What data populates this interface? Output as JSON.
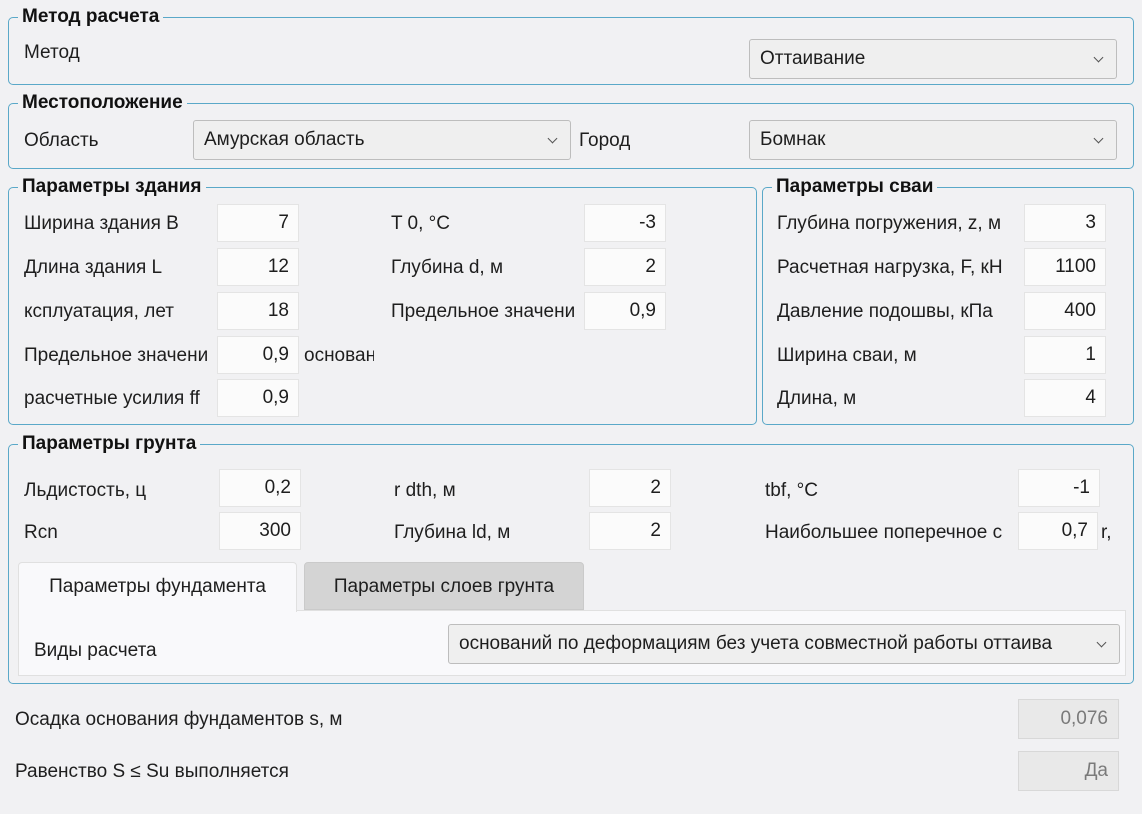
{
  "method_group": {
    "title": "Метод расчета",
    "method_label": "Метод",
    "method_value": "Оттаивание"
  },
  "location_group": {
    "title": "Местоположение",
    "region_label": "Область",
    "region_value": "Амурская область",
    "city_label": "Город",
    "city_value": "Бомнак"
  },
  "building_group": {
    "title": "Параметры здания",
    "width_label": "Ширина здания B",
    "width_value": "7",
    "length_label": "Длина здания L",
    "length_value": "12",
    "exploitation_label": "ксплуатация, лет",
    "exploitation_value": "18",
    "limit_label": "Предельное значени",
    "limit_value": "0,9",
    "limit_suffix": "основан",
    "forces_label": "расчетные усилия ff",
    "forces_value": "0,9",
    "t0_label": "T 0, °C",
    "t0_value": "-3",
    "depth_label": "Глубина d, м",
    "depth_value": "2",
    "limit2_label": "Предельное значени",
    "limit2_value": "0,9"
  },
  "pile_group": {
    "title": "Параметры сваи",
    "immersion_label": "Глубина погружения, z, м",
    "immersion_value": "3",
    "load_label": "Расчетная нагрузка, F, кН",
    "load_value": "1100",
    "pressure_label": "Давление подошвы, кПа",
    "pressure_value": "400",
    "width_label": "Ширина сваи, м",
    "width_value": "1",
    "length_label": "Длина, м",
    "length_value": "4"
  },
  "soil_group": {
    "title": "Параметры грунта",
    "ice_label": "Льдистость, ц",
    "ice_value": "0,2",
    "rcn_label": "Rcn",
    "rcn_value": "300",
    "rdth_label": "r dth, м",
    "rdth_value": "2",
    "ld_label": "Глубина ld, м",
    "ld_value": "2",
    "tbf_label": "tbf, °C",
    "tbf_value": "-1",
    "cross_label": "Наибольшее поперечное с",
    "cross_value": "0,7",
    "cross_suffix": "r,"
  },
  "tabs": {
    "foundation": "Параметры фундамента",
    "layers": "Параметры слоев грунта"
  },
  "foundation_tab": {
    "calc_type_label": "Виды расчета",
    "calc_type_value": "оснований по деформациям без учета совместной работы оттаива"
  },
  "results": {
    "settlement_label": "Осадка основания фундаментов s, м",
    "settlement_value": "0,076",
    "equality_label": "Равенство S ≤ Su выполняется",
    "equality_value": "Да"
  },
  "colors": {
    "group_border": "#5aa8c8",
    "background": "#f1f1f3"
  }
}
